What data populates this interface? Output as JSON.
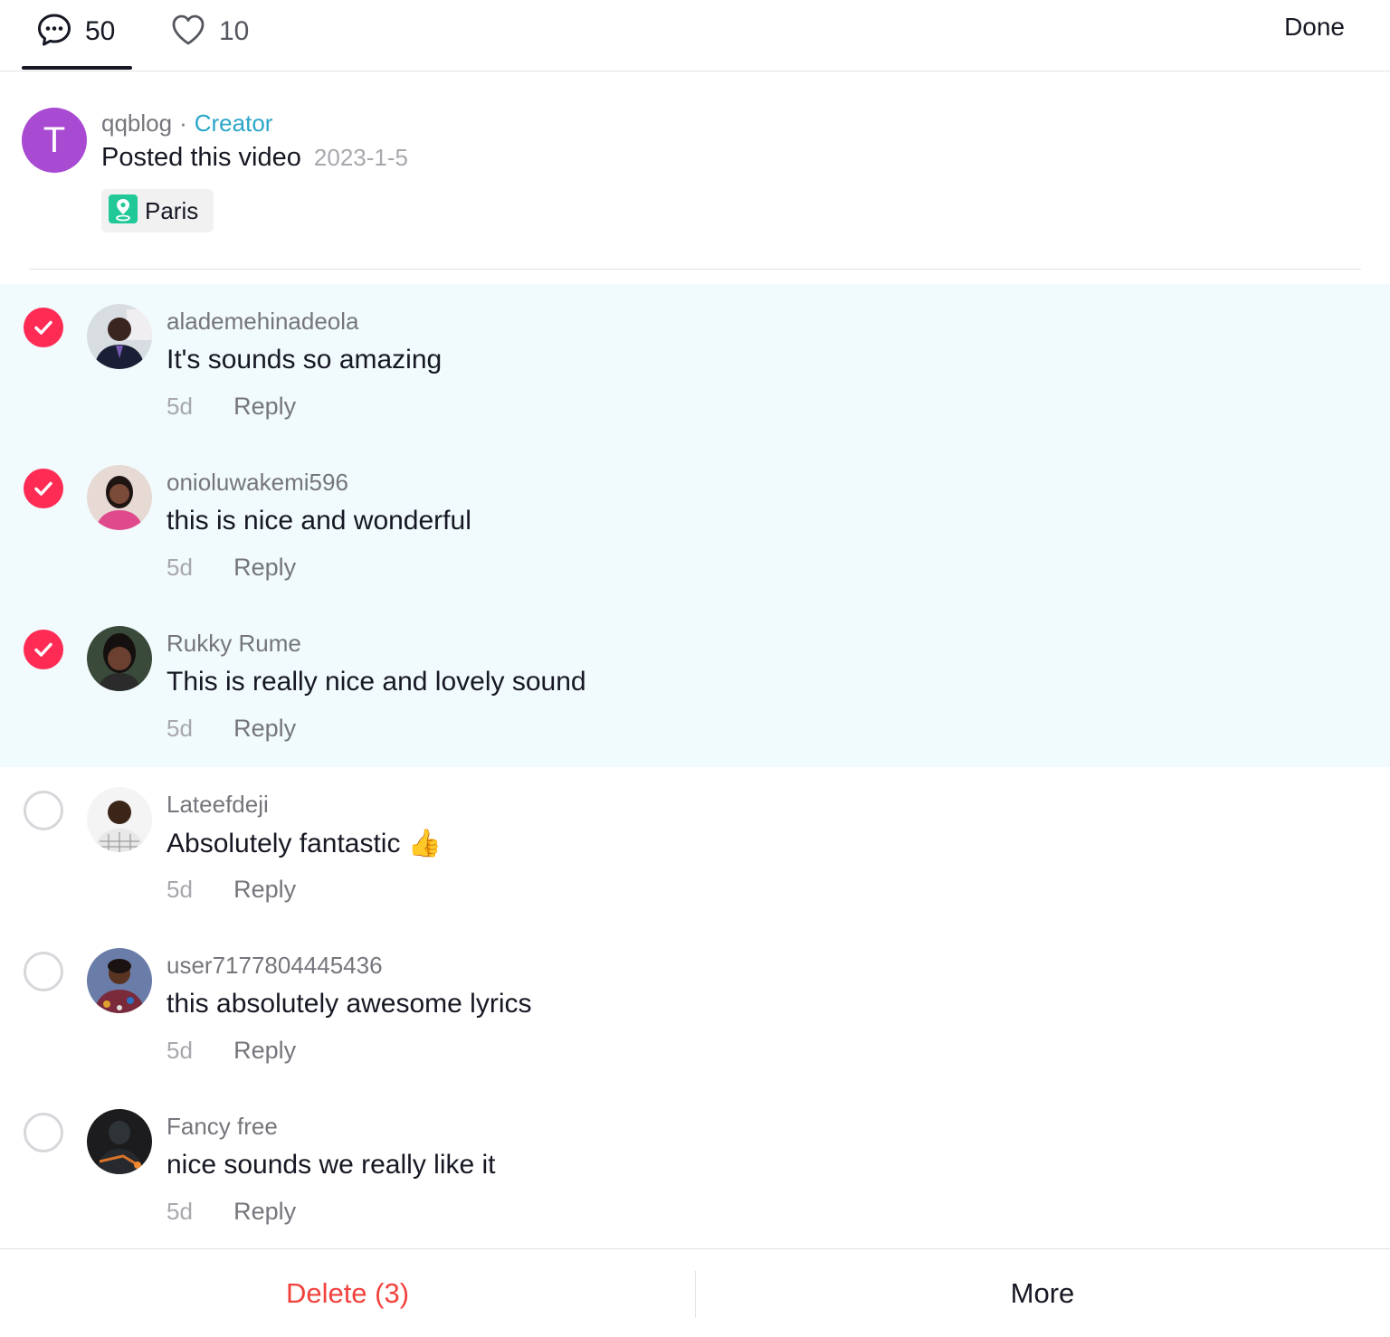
{
  "tabs": {
    "comments": {
      "icon": "comment-bubble-icon",
      "count": "50"
    },
    "likes": {
      "icon": "heart-icon",
      "count": "10"
    },
    "done_label": "Done"
  },
  "post": {
    "avatar_letter": "T",
    "username": "qqblog",
    "separator": "·",
    "badge": "Creator",
    "posted_text": "Posted this video",
    "date": "2023-1-5",
    "location": {
      "icon": "map-pin-icon",
      "label": "Paris"
    }
  },
  "comments": [
    {
      "username": "alademehinadeola",
      "text": "It's sounds so amazing",
      "time": "5d",
      "reply_label": "Reply",
      "selected": true
    },
    {
      "username": "onioluwakemi596",
      "text": "this is nice and wonderful",
      "time": "5d",
      "reply_label": "Reply",
      "selected": true
    },
    {
      "username": "Rukky Rume",
      "text": "This is really nice and lovely sound",
      "time": "5d",
      "reply_label": "Reply",
      "selected": true
    },
    {
      "username": "Lateefdeji",
      "text": "Absolutely fantastic 👍",
      "time": "5d",
      "reply_label": "Reply",
      "selected": false
    },
    {
      "username": "user7177804445436",
      "text": "this absolutely awesome lyrics",
      "time": "5d",
      "reply_label": "Reply",
      "selected": false
    },
    {
      "username": "Fancy free",
      "text": "nice sounds we really like it",
      "time": "5d",
      "reply_label": "Reply",
      "selected": false
    }
  ],
  "actions": {
    "delete_label": "Delete (3)",
    "more_label": "More"
  },
  "colors": {
    "accent_red": "#fe2c55",
    "delete_red": "#f0433e",
    "creator_badge": "#2aa6c9",
    "selected_row_bg": "#f1fafc",
    "creator_avatar": "#a84ad2"
  }
}
